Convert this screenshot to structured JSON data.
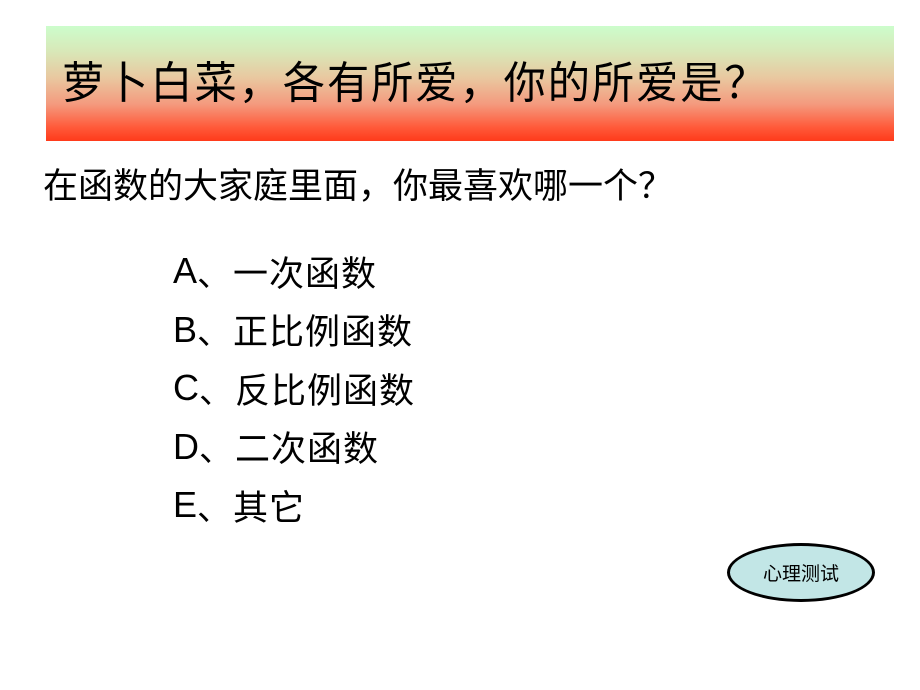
{
  "banner": {
    "title": "萝卜白菜，各有所爱，你的所爱是？",
    "gradient_colors": [
      "#ccfdcc",
      "#e9c8a0",
      "#ff3a1a"
    ]
  },
  "question": "在函数的大家庭里面，你最喜欢哪一个？",
  "options": [
    {
      "letter": "A",
      "separator": "、",
      "text": "一次函数"
    },
    {
      "letter": "B",
      "separator": "、",
      "text": "正比例函数"
    },
    {
      "letter": "C",
      "separator": "、",
      "text": "反比例函数"
    },
    {
      "letter": "D",
      "separator": "、",
      "text": "二次函数"
    },
    {
      "letter": "E",
      "separator": "、",
      "text": "其它"
    }
  ],
  "test_button": {
    "label": "心理测试",
    "fill_color": "#c2e6e6",
    "border_color": "#000000"
  }
}
